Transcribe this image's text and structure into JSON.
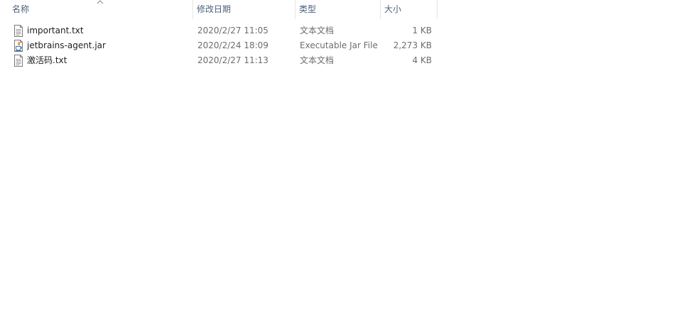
{
  "columns": {
    "name": "名称",
    "date": "修改日期",
    "type": "类型",
    "size": "大小"
  },
  "sort": {
    "column": "name",
    "direction": "ascending",
    "indicator_icon": "chevron-up-icon"
  },
  "files": [
    {
      "name": "important.txt",
      "modified": "2020/2/27 11:05",
      "type": "文本文档",
      "size": "1 KB",
      "icon": "text-file-icon"
    },
    {
      "name": "jetbrains-agent.jar",
      "modified": "2020/2/24 18:09",
      "type": "Executable Jar File",
      "size": "2,273 KB",
      "icon": "java-jar-icon"
    },
    {
      "name": "激活码.txt",
      "modified": "2020/2/27 11:13",
      "type": "文本文档",
      "size": "4 KB",
      "icon": "text-file-icon"
    }
  ]
}
